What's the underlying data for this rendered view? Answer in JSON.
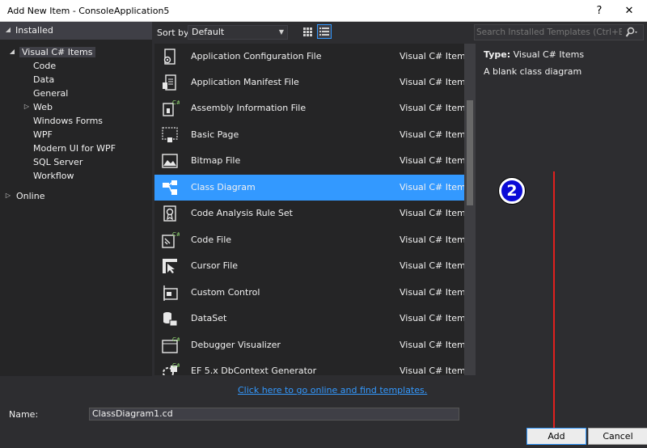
{
  "window": {
    "title": "Add New Item - ConsoleApplication5",
    "help_label": "?",
    "close_label": "✕"
  },
  "tree": {
    "installed_label": "Installed",
    "visual_cs_label": "Visual C# Items",
    "children": [
      "Code",
      "Data",
      "General",
      "Web",
      "Windows Forms",
      "WPF",
      "Modern UI for WPF",
      "SQL Server",
      "Workflow"
    ],
    "online_label": "Online"
  },
  "sortbar": {
    "label": "Sort by:",
    "value": "Default"
  },
  "search": {
    "placeholder": "Search Installed Templates (Ctrl+E)"
  },
  "items": [
    {
      "name": "Application Configuration File",
      "category": "Visual C# Items",
      "icon": "config-file-icon"
    },
    {
      "name": "Application Manifest File",
      "category": "Visual C# Items",
      "icon": "manifest-file-icon"
    },
    {
      "name": "Assembly Information File",
      "category": "Visual C# Items",
      "icon": "assembly-info-icon"
    },
    {
      "name": "Basic Page",
      "category": "Visual C# Items",
      "icon": "basic-page-icon"
    },
    {
      "name": "Bitmap File",
      "category": "Visual C# Items",
      "icon": "bitmap-icon"
    },
    {
      "name": "Class Diagram",
      "category": "Visual C# Items",
      "icon": "class-diagram-icon",
      "selected": true
    },
    {
      "name": "Code Analysis Rule Set",
      "category": "Visual C# Items",
      "icon": "rule-set-icon"
    },
    {
      "name": "Code File",
      "category": "Visual C# Items",
      "icon": "code-file-icon"
    },
    {
      "name": "Cursor File",
      "category": "Visual C# Items",
      "icon": "cursor-icon"
    },
    {
      "name": "Custom Control",
      "category": "Visual C# Items",
      "icon": "custom-control-icon"
    },
    {
      "name": "DataSet",
      "category": "Visual C# Items",
      "icon": "dataset-icon"
    },
    {
      "name": "Debugger Visualizer",
      "category": "Visual C# Items",
      "icon": "debugger-visualizer-icon"
    },
    {
      "name": "EF 5.x DbContext Generator",
      "category": "Visual C# Items",
      "icon": "ef-generator-icon"
    }
  ],
  "details": {
    "type_label": "Type:",
    "type_value": "Visual C# Items",
    "description": "A blank class diagram"
  },
  "annotation": {
    "badge": "2"
  },
  "online_link": "Click here to go online and find templates.",
  "name_field": {
    "label": "Name:",
    "value": "ClassDiagram1.cd"
  },
  "buttons": {
    "add": "Add",
    "cancel": "Cancel"
  },
  "colors": {
    "selection": "#3399ff",
    "background": "#2d2d30",
    "annotation_arrow": "#e0201e",
    "badge": "#0a0ad6"
  }
}
